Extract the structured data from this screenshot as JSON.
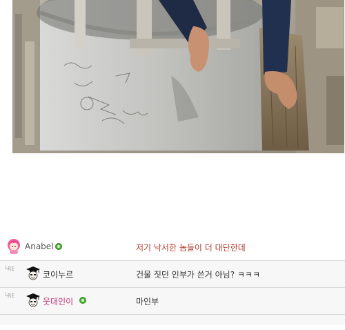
{
  "photo": {
    "alt_icon": "building-top-photo"
  },
  "comments": [
    {
      "nickname": "Anabel",
      "text": "저기 낙서한 놈들이 더 대단한데",
      "is_reply": false,
      "nick_color": "#555555",
      "text_color": "#b5392d",
      "avatar": "pink-hair-avatar-icon",
      "online": true
    },
    {
      "nickname": "코이누르",
      "text": "건물 짓던 인부가 쓴거 아님? ㅋㅋㅋ",
      "is_reply": true,
      "reply_mark": "└RE",
      "nick_color": "#222222",
      "text_color": "#333333",
      "avatar": "graduate-cap-avatar-icon",
      "online": false
    },
    {
      "nickname": "웃대인이",
      "text": "마인부",
      "is_reply": true,
      "reply_mark": "└RE",
      "nick_color": "#c0397b",
      "text_color": "#333333",
      "avatar": "graduate-cap-avatar-icon",
      "online": true
    }
  ]
}
